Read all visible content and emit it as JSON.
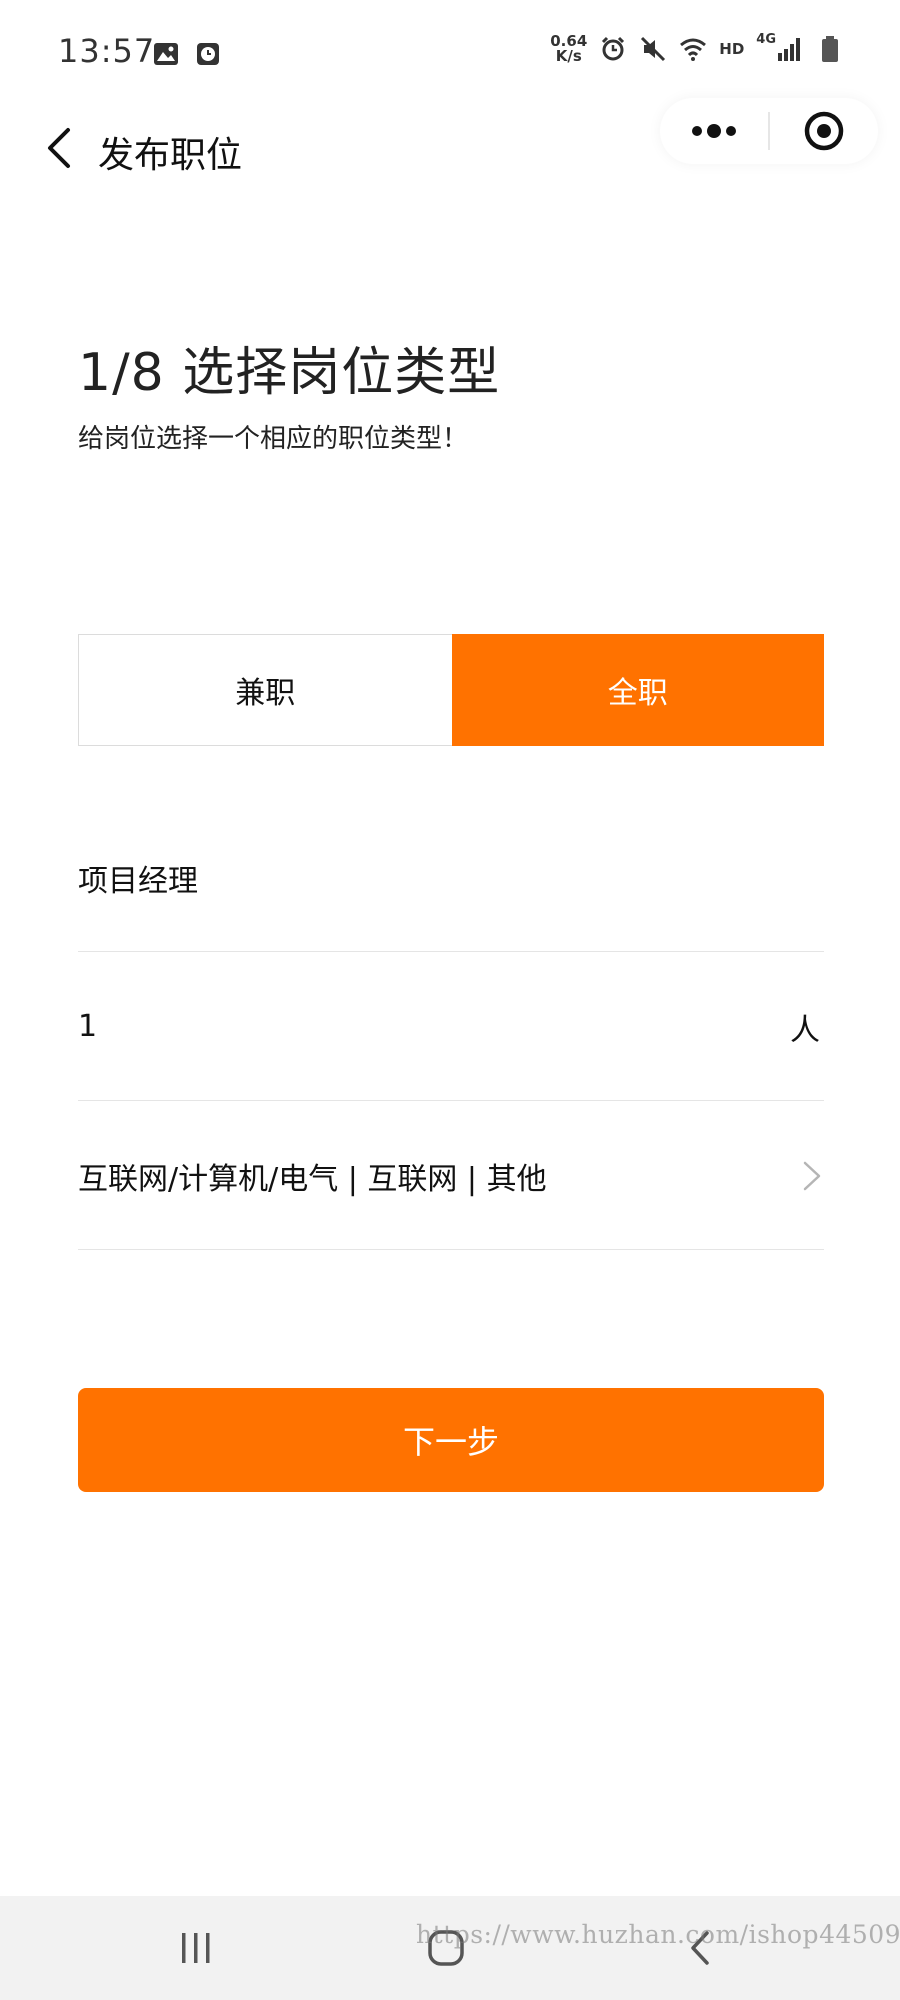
{
  "status_bar": {
    "time": "13:57",
    "net_speed_value": "0.64",
    "net_speed_unit": "K/s",
    "hd_label": "HD",
    "network_label": "4G",
    "icons": [
      "image-icon",
      "clock-app-icon",
      "alarm-icon",
      "mute-icon",
      "wifi-icon",
      "signal-icon",
      "battery-icon"
    ]
  },
  "nav": {
    "title": "发布职位",
    "back_icon": "chevron-left-icon",
    "more_icon": "more-dots-icon",
    "close_icon": "target-circle-icon"
  },
  "header": {
    "step_title": "1/8 选择岗位类型",
    "subtitle": "给岗位选择一个相应的职位类型！"
  },
  "job_type": {
    "options": [
      {
        "label": "兼职",
        "selected": false
      },
      {
        "label": "全职",
        "selected": true
      }
    ]
  },
  "form": {
    "job_title_value": "项目经理",
    "headcount_value": "1",
    "headcount_unit": "人",
    "category_text": "互联网/计算机/电气 | 互联网 | 其他"
  },
  "actions": {
    "next_label": "下一步"
  },
  "watermark": {
    "text": "https://www.huzhan.com/ishop44509"
  },
  "colors": {
    "accent": "#ff7200",
    "text": "#111111",
    "divider": "#e5e5e5",
    "system_nav_bg": "#f2f2f2"
  }
}
